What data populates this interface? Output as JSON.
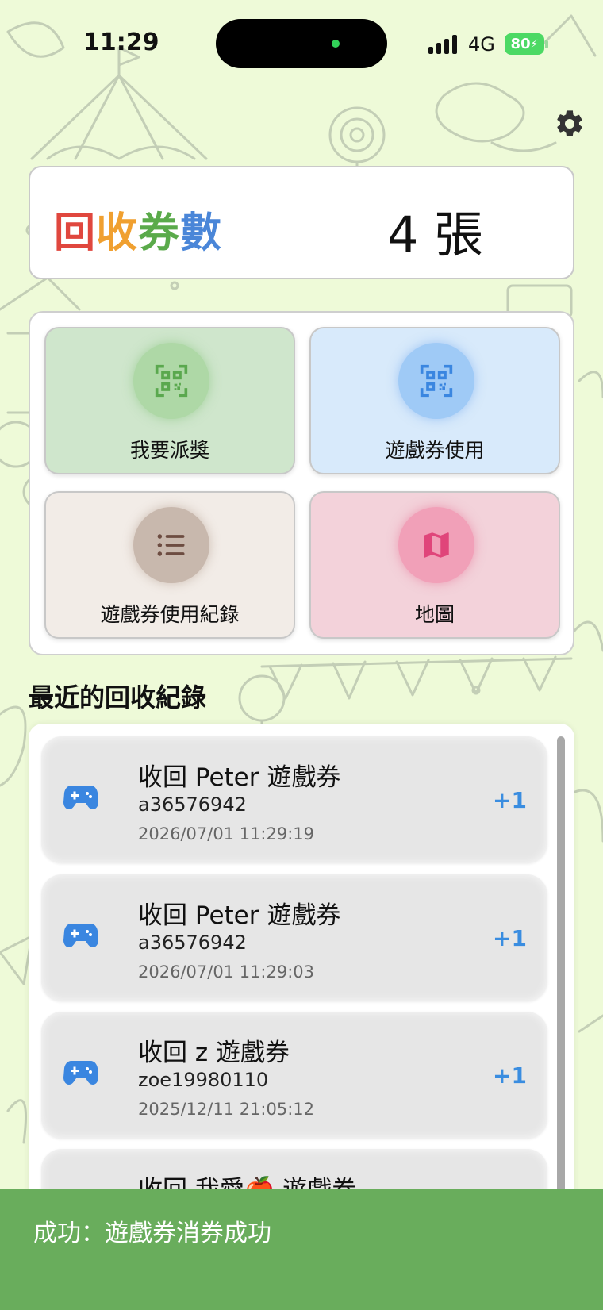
{
  "status_bar": {
    "time": "11:29",
    "network": "4G",
    "battery": "80"
  },
  "summary": {
    "title_chars": [
      "回",
      "收",
      "券",
      "數"
    ],
    "count_text": "4 張"
  },
  "menu": {
    "award_label": "我要派獎",
    "use_label": "遊戲券使用",
    "history_label": "遊戲券使用紀錄",
    "map_label": "地圖"
  },
  "records": {
    "section_title": "最近的回收紀錄",
    "items": [
      {
        "title": "收回 Peter 遊戲券",
        "user": "a36576942",
        "time": "2026/07/01 11:29:19",
        "delta": "+1"
      },
      {
        "title": "收回 Peter 遊戲券",
        "user": "a36576942",
        "time": "2026/07/01 11:29:03",
        "delta": "+1"
      },
      {
        "title": "收回 z 遊戲券",
        "user": "zoe19980110",
        "time": "2025/12/11 21:05:12",
        "delta": "+1"
      },
      {
        "title": "收回 我愛🍎 遊戲券",
        "user": "",
        "time": "",
        "delta": ""
      }
    ]
  },
  "toast": {
    "message": "成功：遊戲券消券成功"
  },
  "colors": {
    "background": "#eefad8",
    "accent_blue": "#3a8de0",
    "toast_green": "#69ad5c"
  }
}
